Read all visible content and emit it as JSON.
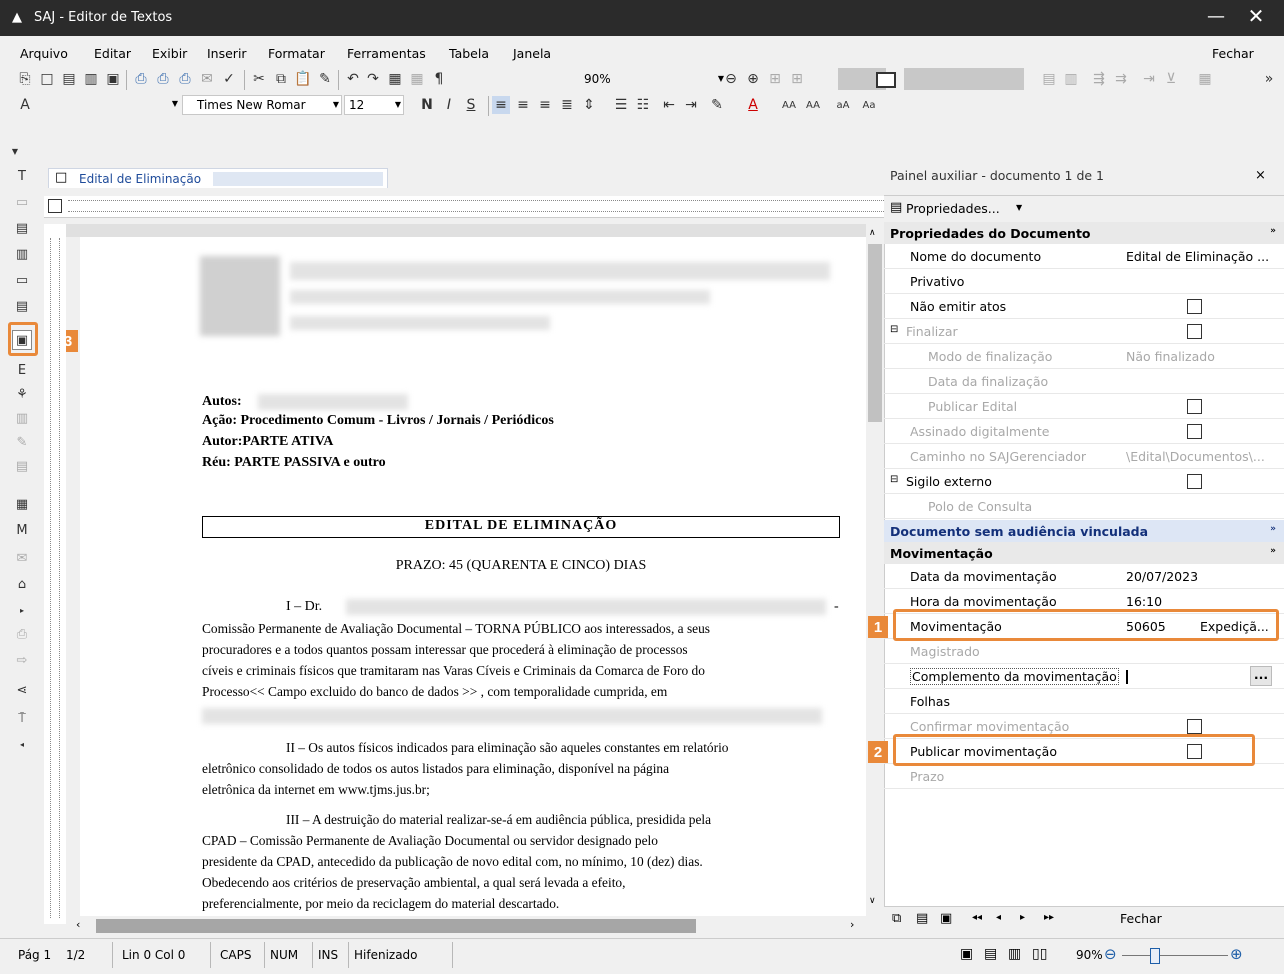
{
  "window": {
    "title": "SAJ - Editor de Textos",
    "minimize": "—",
    "close": "✕"
  },
  "menu": {
    "items": [
      "Arquivo",
      "Editar",
      "Exibir",
      "Inserir",
      "Formatar",
      "Ferramentas",
      "Tabela",
      "Janela"
    ],
    "close_label": "Fechar"
  },
  "toolbar": {
    "zoom": "90%",
    "font_name": "Times New Romar",
    "font_size": "12"
  },
  "document_tab": {
    "label": "Edital de Eliminação"
  },
  "document": {
    "autos_label": "Autos:",
    "acao": "Ação: Procedimento Comum - Livros / Jornais / Periódicos",
    "autor": "Autor:PARTE ATIVA",
    "reu": "Réu: PARTE PASSIVA e outro",
    "heading": "EDITAL DE ELIMINAÇÃO",
    "prazo": "PRAZO: 45 (QUARENTA E CINCO) DIAS",
    "p1_start": "I – Dr.",
    "p1_dash": "-",
    "p1_l2": "Comissão Permanente de Avaliação Documental – TORNA PÚBLICO aos interessados, a seus",
    "p1_l3": "procuradores e a todos quantos possam interessar que procederá à eliminação de processos",
    "p1_l4": "cíveis e criminais físicos que tramitaram nas Varas Cíveis e Criminais da Comarca de Foro do",
    "p1_l5": "Processo<< Campo excluido do banco de dados >> , com temporalidade cumprida, em",
    "p2_l1": "II – Os autos físicos indicados para eliminação são aqueles constantes em relatório",
    "p2_l2": "eletrônico consolidado de todos os autos listados para eliminação, disponível na página",
    "p2_l3": "eletrônica da internet em www.tjms.jus.br;",
    "p3_l1": "III – A destruição do material realizar-se-á em audiência pública, presidida pela",
    "p3_l2": "CPAD – Comissão Permanente de Avaliação Documental ou servidor designado pelo",
    "p3_l3": "presidente da CPAD, antecedido da publicação de novo edital com, no mínimo, 10 (dez) dias.",
    "p3_l4": "Obedecendo aos critérios de preservação ambiental, a qual será levada a efeito,",
    "p3_l5": "preferencialmente, por meio da reciclagem do material descartado."
  },
  "panel": {
    "title": "Painel auxiliar - documento 1 de 1",
    "close": "×",
    "properties_button": "Propriedades...",
    "section1": "Propriedades do Documento",
    "rows1": {
      "nome_label": "Nome do documento",
      "nome_value": "Edital de Eliminação ...",
      "privativo": "Privativo",
      "nao_emitir": "Não emitir atos",
      "finalizar": "Finalizar",
      "modo_label": "Modo de finalização",
      "modo_value": "Não finalizado",
      "data_final": "Data da finalização",
      "publicar_edital": "Publicar Edital",
      "assinado": "Assinado digitalmente",
      "caminho_label": "Caminho no SAJGerenciador",
      "caminho_value": "\\Edital\\Documentos\\...",
      "sigilo": "Sigilo externo",
      "polo": "Polo de Consulta"
    },
    "section2": "Documento sem audiência vinculada",
    "section3": "Movimentação",
    "rows3": {
      "data_label": "Data da movimentação",
      "data_value": "20/07/2023",
      "hora_label": "Hora da movimentação",
      "hora_value": "16:10",
      "mov_label": "Movimentação",
      "mov_code": "50605",
      "mov_desc": "Expediçã...",
      "magistrado": "Magistrado",
      "complemento": "Complemento da movimentação",
      "complemento_btn": "...",
      "folhas": "Folhas",
      "confirmar": "Confirmar movimentação",
      "publicar_mov": "Publicar movimentação",
      "prazo": "Prazo"
    },
    "bottom_close": "Fechar"
  },
  "badges": {
    "b1": "1",
    "b2": "2",
    "b3": "3"
  },
  "status": {
    "page": "Pág 1",
    "pages": "1/2",
    "position": "Lin 0 Col 0",
    "caps": "CAPS",
    "num": "NUM",
    "ins": "INS",
    "hyphen": "Hifenizado",
    "zoom": "90%"
  },
  "colors": {
    "accent_orange": "#e9893a",
    "link_blue": "#1e4b9a",
    "section_blue": "#13307a"
  }
}
